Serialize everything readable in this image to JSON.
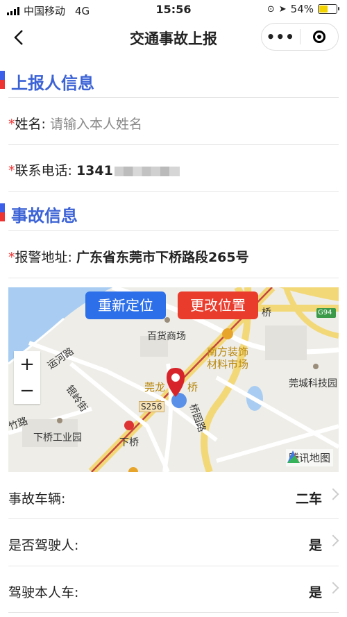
{
  "status": {
    "carrier": "中国移动",
    "network": "4G",
    "time": "15:56",
    "battery": "54%",
    "battery_level": 0.54
  },
  "nav": {
    "title": "交通事故上报",
    "more": "•••"
  },
  "reporter": {
    "section_title": "上报人信息",
    "name_label": "姓名:",
    "name_placeholder": "请输入本人姓名",
    "phone_label": "联系电话:",
    "phone_value": "1341"
  },
  "accident": {
    "section_title": "事故信息",
    "address_label": "报警地址:",
    "address_value": "广东省东莞市下桥路段265号"
  },
  "map": {
    "relocate_label": "重新定位",
    "change_label": "更改位置",
    "zoom_in": "+",
    "zoom_out": "−",
    "labels": {
      "baihuo": "百货商场",
      "nanfang": "南方装饰 材料市场",
      "guancheng": "莞城科技园",
      "xiaqiao_ind": "下桥工业园",
      "xiaqiao": "下桥",
      "guanlong": "莞龙",
      "qiao": "桥",
      "s256": "S256",
      "g94": "G94",
      "yunhe": "运河路",
      "yinling": "银岭街",
      "zhu": "竹路",
      "qiao2": "桥",
      "qiaoyuan": "桥园路"
    },
    "brand": "腾讯地图"
  },
  "options": [
    {
      "label": "事故车辆:",
      "value": "二车"
    },
    {
      "label": "是否驾驶人:",
      "value": "是"
    },
    {
      "label": "驾驶本人车:",
      "value": "是"
    }
  ],
  "colors": {
    "accent_blue": "#3c63d6",
    "required_red": "#e33333",
    "relocate_btn": "#2d6fe8",
    "change_btn": "#ea3c2c"
  }
}
